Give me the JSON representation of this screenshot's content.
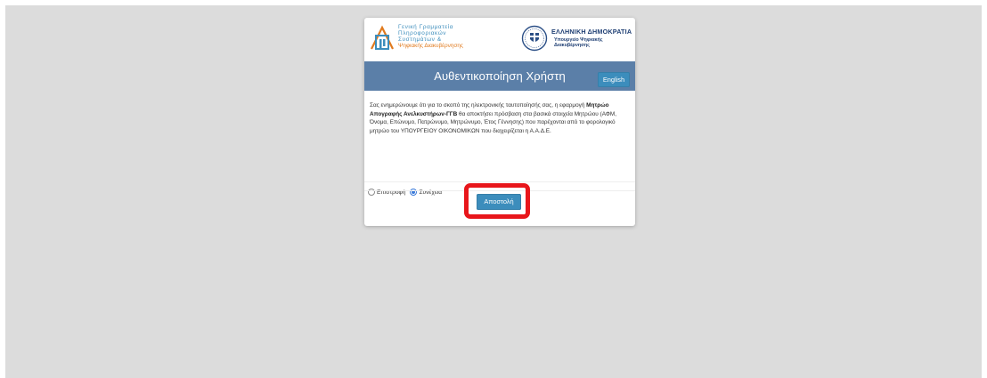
{
  "header": {
    "gsis_logo_lines": [
      "Γενική Γραμματεία",
      "Πληροφοριακών",
      "Συστημάτων &"
    ],
    "gsis_logo_orange": "Ψηφιακής Διακυβέρνησης",
    "republic_title": "ΕΛΛΗΝΙΚΗ ΔΗΜΟΚΡΑΤΙΑ",
    "ministry_line1": "Υπουργείο Ψηφιακής",
    "ministry_line2": "Διακυβέρνησης"
  },
  "titlebar": {
    "title": "Αυθεντικοποίηση Χρήστη",
    "language_button": "English"
  },
  "notice": {
    "part1": "Σας ενημερώνουμε ότι για το σκοπό της ηλεκτρονικής ταυτοποίησής σας, η εφαρμογή ",
    "app_name": "Μητρώο Απογραφής Ανελκυστήρων-ΓΓΒ",
    "part2": " θα αποκτήσει πρόσβαση στα βασικά στοιχεία Μητρώου (ΑΦΜ, Όνομα, Επώνυμο, Πατρώνυμο, Μητρώνυμο, Έτος Γέννησης) που παρέχονται από το φορολογικό μητρώο του ΥΠΟΥΡΓΕΙΟΥ ΟΙΚΟΝΟΜΙΚΩΝ που διαχειρίζεται η Α.Α.Δ.Ε."
  },
  "options": {
    "back_label": "Επιστροφή",
    "continue_label": "Συνέχεια",
    "selected": "Συνέχεια"
  },
  "actions": {
    "submit_label": "Αποστολή"
  },
  "colors": {
    "titlebar": "#5b7fa8",
    "primary_button": "#3c8dbc",
    "highlight": "#e8161b"
  }
}
